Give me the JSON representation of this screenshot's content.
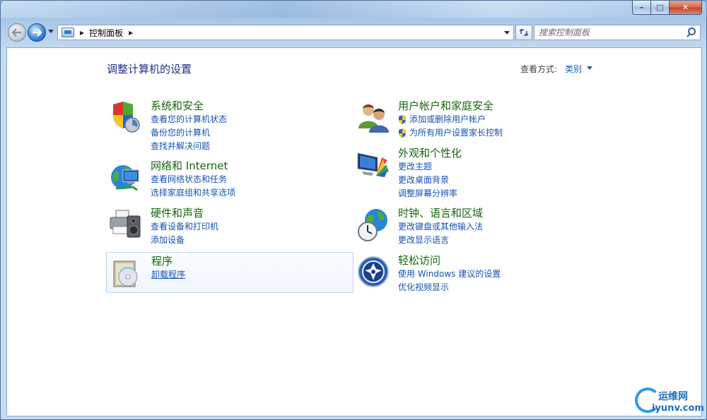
{
  "window": {
    "controls": {
      "minimize": "–",
      "maximize": "□",
      "close": "✕"
    }
  },
  "navbar": {
    "back_icon": "back-arrow-icon",
    "forward_icon": "forward-arrow-icon",
    "breadcrumb": [
      "控制面板"
    ],
    "search_placeholder": "搜索控制面板"
  },
  "main": {
    "title": "调整计算机的设置",
    "view_by_label": "查看方式:",
    "view_by_value": "类别",
    "categories_left": [
      {
        "title": "系统和安全",
        "icon": "shield-computer-icon",
        "links": [
          "查看您的计算机状态",
          "备份您的计算机",
          "查找并解决问题"
        ]
      },
      {
        "title": "网络和 Internet",
        "icon": "globe-network-icon",
        "links": [
          "查看网络状态和任务",
          "选择家庭组和共享选项"
        ]
      },
      {
        "title": "硬件和声音",
        "icon": "printer-speaker-icon",
        "links": [
          "查看设备和打印机",
          "添加设备"
        ]
      },
      {
        "title": "程序",
        "icon": "program-disc-icon",
        "links": [
          "卸载程序"
        ]
      }
    ],
    "categories_right": [
      {
        "title": "用户帐户和家庭安全",
        "icon": "users-icon",
        "links": [
          "添加或删除用户帐户",
          "为所有用户设置家长控制"
        ]
      },
      {
        "title": "外观和个性化",
        "icon": "monitor-palette-icon",
        "links": [
          "更改主题",
          "更改桌面背景",
          "调整屏幕分辨率"
        ]
      },
      {
        "title": "时钟、语言和区域",
        "icon": "clock-globe-icon",
        "links": [
          "更改键盘或其他输入法",
          "更改显示语言"
        ]
      },
      {
        "title": "轻松访问",
        "icon": "ease-of-access-icon",
        "links": [
          "使用 Windows 建议的设置",
          "优化视频显示"
        ]
      }
    ]
  },
  "watermark": {
    "line1": "运维网",
    "line2": "iyunv.com"
  }
}
